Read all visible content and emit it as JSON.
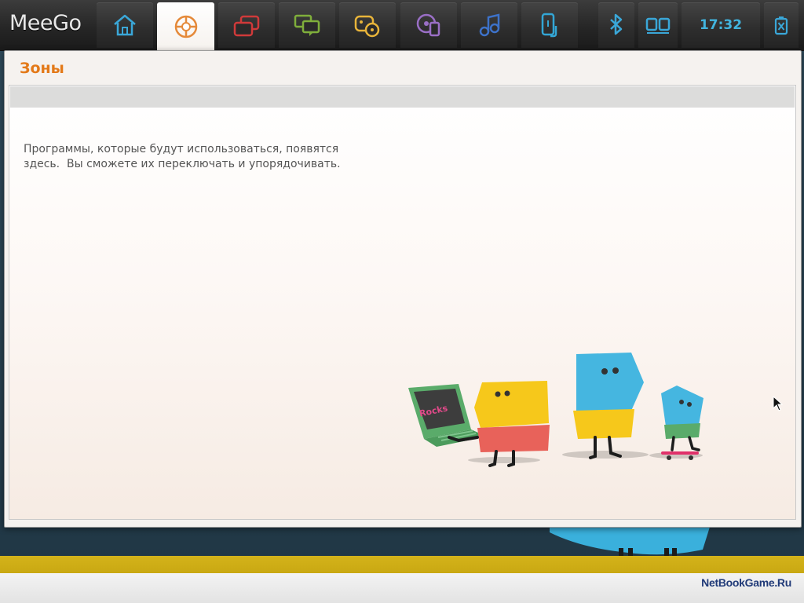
{
  "toolbar": {
    "logo": "MeeGo",
    "clock": "17:32",
    "buttons": [
      {
        "name": "myzone",
        "icon": "home-icon",
        "color": "#3aa7d8"
      },
      {
        "name": "zones",
        "icon": "zones-icon",
        "color": "#e58a3a",
        "active": true
      },
      {
        "name": "status",
        "icon": "windows-icon",
        "color": "#d03a3a"
      },
      {
        "name": "people",
        "icon": "chat-icon",
        "color": "#7fae3b"
      },
      {
        "name": "games",
        "icon": "games-icon",
        "color": "#e8b43a"
      },
      {
        "name": "media",
        "icon": "media-icon",
        "color": "#9a6fc6"
      },
      {
        "name": "music",
        "icon": "music-icon",
        "color": "#3d72c9"
      },
      {
        "name": "devices",
        "icon": "device-icon",
        "color": "#33a6d5"
      },
      {
        "name": "bluetooth",
        "icon": "bluetooth-icon",
        "color": "#3aa7d8"
      },
      {
        "name": "multitask",
        "icon": "multi-window-icon",
        "color": "#3aa7d8"
      },
      {
        "name": "battery",
        "icon": "battery-icon",
        "color": "#3aa7d8"
      }
    ]
  },
  "window": {
    "title": "Зоны",
    "empty_message": "Программы, которые будут использоваться, появятся\nздесь.  Вы сможете их переключать и упорядочивать.",
    "laptop_text": "Rocks"
  },
  "colors": {
    "accent": "#e37918",
    "clock": "#42b4de",
    "yellow": "#f6c81b",
    "blue": "#45b6e0",
    "red": "#e8625a",
    "green": "#5aab6a"
  },
  "watermark": "NetBookGame.Ru"
}
